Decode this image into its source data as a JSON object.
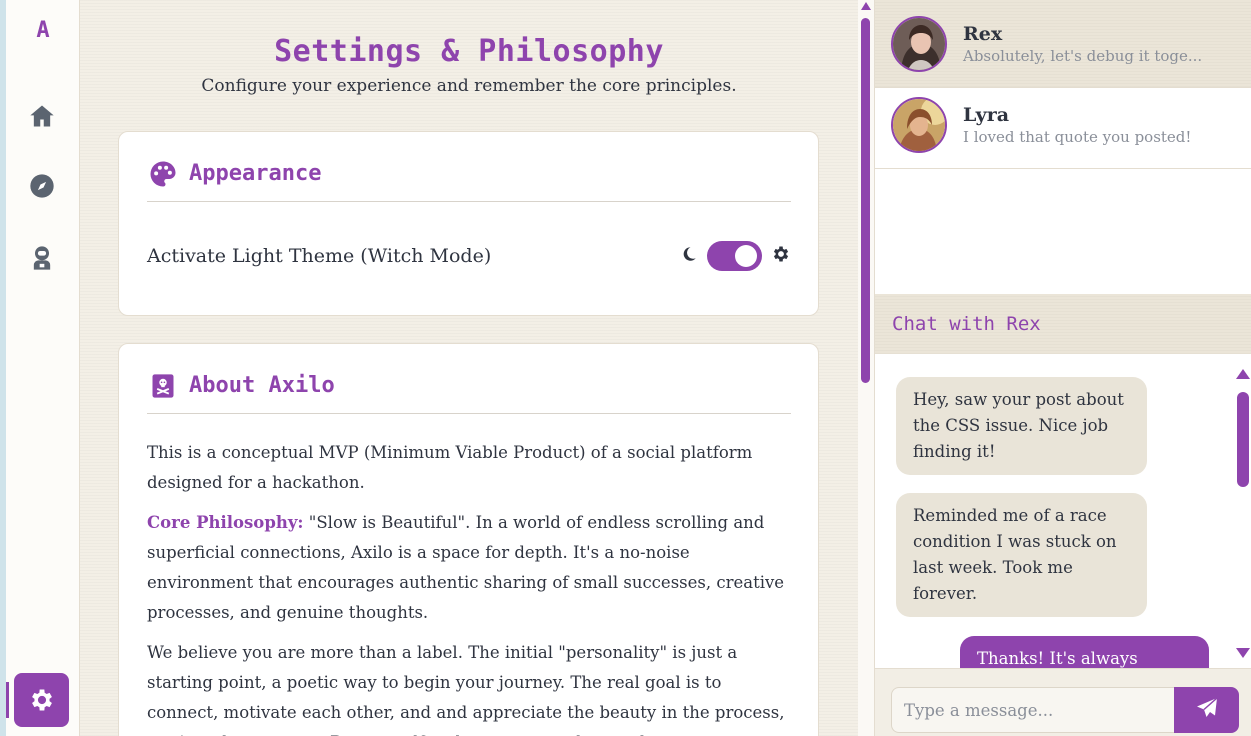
{
  "sidebar": {
    "logo": "A",
    "items": [
      {
        "icon": "home-icon"
      },
      {
        "icon": "compass-icon"
      },
      {
        "icon": "astronaut-icon"
      },
      {
        "icon": "gear-icon",
        "active": true
      }
    ]
  },
  "main": {
    "title": "Settings & Philosophy",
    "subtitle": "Configure your experience and remember the core principles.",
    "appearance": {
      "title": "Appearance",
      "icon": "palette-icon",
      "theme_label": "Activate Light Theme (Witch Mode)",
      "toggle_on": true
    },
    "about": {
      "title": "About Axilo",
      "icon": "book-skull-icon",
      "p1": "This is a conceptual MVP (Minimum Viable Product) of a social platform designed for a hackathon.",
      "p2_label": "Core Philosophy:",
      "p2_text": " \"Slow is Beautiful\". In a world of endless scrolling and superficial connections, Axilo is a space for depth. It's a no-noise environment that encourages authentic sharing of small successes, creative processes, and genuine thoughts.",
      "p3": "We believe you are more than a label. The initial \"personality\" is just a starting point, a poetic way to begin your journey. The real goal is to connect, motivate each other, and and appreciate the beauty in the process, not just the outcome. Be yourself and encourage others to be..."
    }
  },
  "conversations": [
    {
      "name": "Rex",
      "preview": "Absolutely, let's debug it toge...",
      "active": true
    },
    {
      "name": "Lyra",
      "preview": "I loved that quote you posted!",
      "active": false
    }
  ],
  "chat": {
    "header": "Chat with Rex",
    "messages": [
      {
        "from": "in",
        "text": "Hey, saw your post about the CSS issue. Nice job finding it!"
      },
      {
        "from": "in",
        "text": "Reminded me of a race condition I was stuck on last week. Took me forever."
      },
      {
        "from": "out",
        "text": "Thanks! It's always"
      }
    ],
    "input_placeholder": "Type a message...",
    "send_icon": "paper-plane-icon"
  },
  "colors": {
    "accent": "#8e44ad",
    "background": "#f3efe6"
  }
}
